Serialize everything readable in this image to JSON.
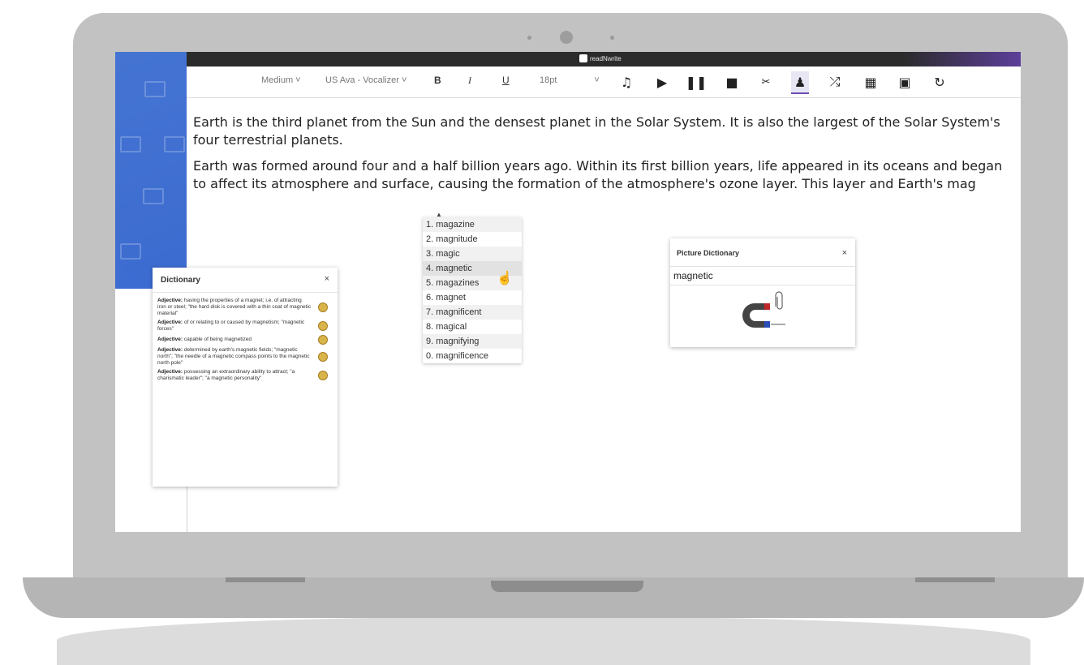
{
  "app": {
    "brand": "readNwrite"
  },
  "toolbar": {
    "speed": "Medium",
    "voice": "US Ava - Vocalizer",
    "bold": "B",
    "italic": "I",
    "underline": "U",
    "font_size": "18pt"
  },
  "document": {
    "paragraphs": [
      "Earth is the third planet from the Sun and the densest planet in the Solar System. It is also the largest of the Solar System's four terrestrial planets.",
      "Earth was formed around four and a half billion years ago. Within its first billion years, life appeared in its oceans and began to affect its atmosphere and surface, causing the formation of the atmosphere's ozone layer. This layer and Earth's mag"
    ]
  },
  "suggestions": [
    "1. magazine",
    "2. magnitude",
    "3. magic",
    "4. magnetic",
    "5. magazines",
    "6. magnet",
    "7. magnificent",
    "8. magical",
    "9. magnifying",
    "0. magnificence"
  ],
  "dictionary": {
    "title": "Dictionary",
    "close": "×",
    "definitions": [
      {
        "pos": "Adjective:",
        "text": " having the properties of a magnet; i.e. of attracting iron or steel; \"the hard disk is covered with a thin coat of magnetic material\""
      },
      {
        "pos": "Adjective:",
        "text": " of or relating to or caused by magnetism; \"magnetic forces\""
      },
      {
        "pos": "Adjective:",
        "text": " capable of being magnetized"
      },
      {
        "pos": "Adjective:",
        "text": " determined by earth's magnetic fields; \"magnetic north\"; \"the needle of a magnetic compass points to the magnetic north pole\""
      },
      {
        "pos": "Adjective:",
        "text": " possessing an extraordinary ability to attract; \"a charismatic leader\"; \"a magnetic personality\""
      }
    ]
  },
  "picture_dictionary": {
    "title": "Picture Dictionary",
    "close": "×",
    "word": "magnetic"
  },
  "colors": {
    "accent": "#6a4bb5",
    "sidebar_blue": "#3d6ccf",
    "titlebar": "#2b2b2b"
  }
}
